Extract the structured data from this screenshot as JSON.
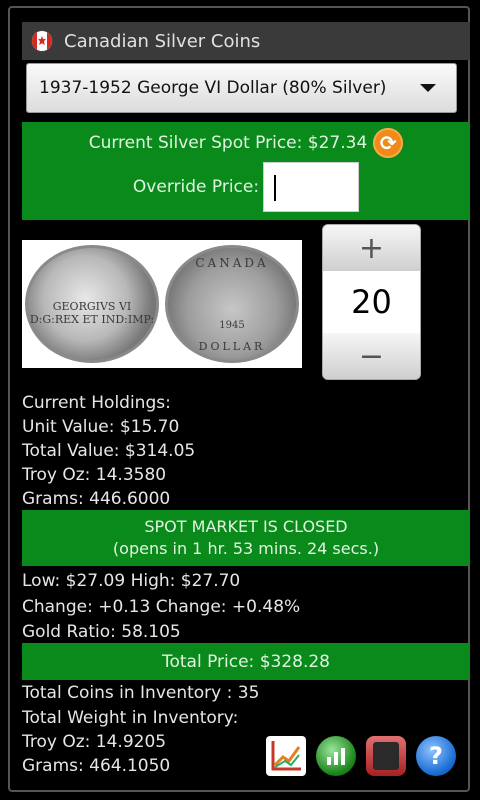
{
  "app": {
    "title": "Canadian Silver Coins",
    "flag_icon": "canada-flag-icon"
  },
  "coin_select": {
    "selected": "1937-1952 George VI Dollar (80% Silver)"
  },
  "price": {
    "spot_label": "Current Silver Spot Price: $27.34",
    "override_label": "Override Price:",
    "override_value": ""
  },
  "coin_images": {
    "obverse_text": "GEORGIVS VI D:G:REX ET IND:IMP:",
    "reverse_top": "CANADA",
    "reverse_year": "1945",
    "reverse_bottom": "DOLLAR"
  },
  "quantity": {
    "plus": "+",
    "value": "20",
    "minus": "−"
  },
  "holdings": {
    "heading": "Current Holdings:",
    "unit_value": "Unit Value: $15.70",
    "total_value": "Total Value: $314.05",
    "troy_oz": "Troy Oz: 14.3580",
    "grams": "Grams: 446.6000"
  },
  "market": {
    "status": "SPOT MARKET IS CLOSED",
    "opens_in": "(opens in 1 hr. 53 mins. 24 secs.)",
    "low_high": "Low: $27.09 High: $27.70",
    "change": "Change: +0.13 Change: +0.48%",
    "gold_ratio": "Gold Ratio: 58.105"
  },
  "total_price": "Total Price: $328.28",
  "inventory": {
    "coins": "Total Coins in Inventory : 35",
    "weight_heading": "Total Weight in Inventory:",
    "troy_oz": "Troy Oz: 14.9205",
    "grams": "Grams: 464.1050"
  },
  "colors": {
    "green_panel": "#0b8a1c",
    "refresh": "#f08a1a"
  },
  "toolbar_icons": [
    "chart-icon",
    "stats-icon",
    "calculator-icon",
    "help-icon"
  ]
}
